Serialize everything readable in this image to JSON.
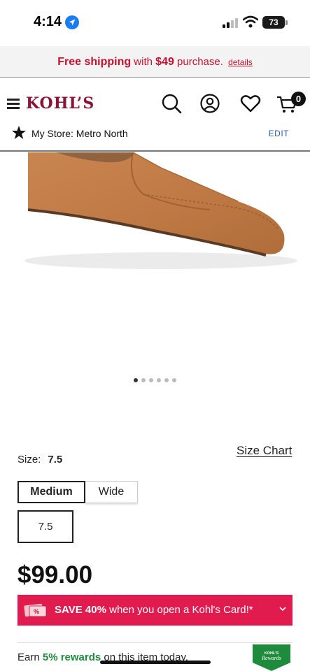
{
  "status_bar": {
    "time": "4:14",
    "battery": "73"
  },
  "promo": {
    "bold_text": "Free shipping",
    "mid_text": " with ",
    "amount": "$49",
    "end_text": " purchase.",
    "details_link": "details"
  },
  "header": {
    "logo": "KOHLS",
    "cart_count": "0",
    "store_label": "My Store: Metro North",
    "edit_label": "EDIT"
  },
  "gallery": {
    "dots_count": 6,
    "active_index": 0
  },
  "size": {
    "chart_link": "Size Chart",
    "label": "Size:",
    "value": "7.5",
    "width_options": [
      "Medium",
      "Wide"
    ],
    "selected_width": "Medium",
    "selected_size": "7.5"
  },
  "price": "$99.00",
  "card_offer": {
    "bold": "SAVE 40%",
    "rest": " when you open a Kohl's Card!*"
  },
  "rewards": {
    "prefix": "Earn ",
    "highlight": "5% rewards",
    "suffix": " on this item today."
  },
  "colors": {
    "brand": "#8b1538",
    "promo_red": "#c8102e",
    "card_pink": "#e11b4d",
    "rewards_green": "#1e8a3c",
    "link_blue": "#2a5db0"
  }
}
